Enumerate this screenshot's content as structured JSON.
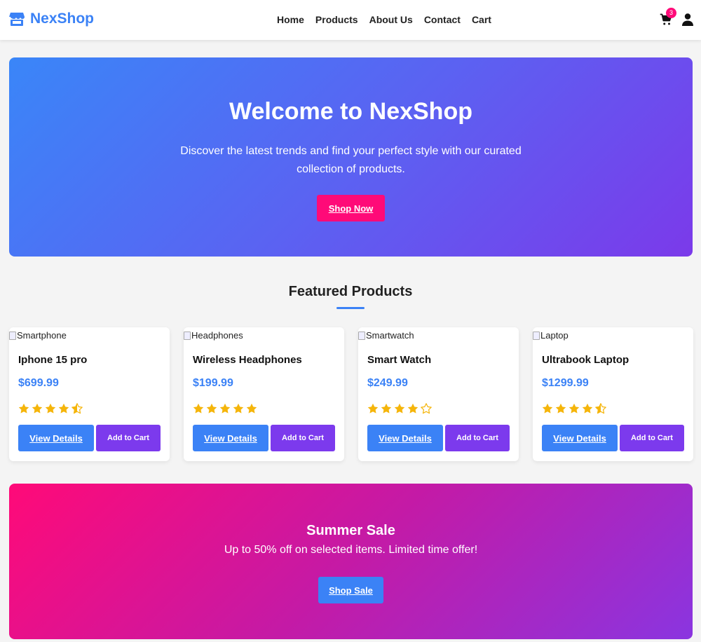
{
  "brand": {
    "name": "NexShop",
    "icon": "store-icon",
    "color": "#3b82f6"
  },
  "nav": {
    "links": [
      "Home",
      "Products",
      "About Us",
      "Contact",
      "Cart"
    ],
    "cart_icon": "shopping-cart-icon",
    "cart_count": "3",
    "user_icon": "user-icon"
  },
  "hero": {
    "title": "Welcome to NexShop",
    "subtitle": "Discover the latest trends and find your perfect style with our curated collection of products.",
    "cta": "Shop Now"
  },
  "featured": {
    "title": "Featured Products",
    "products": [
      {
        "image_alt": "Smartphone",
        "name": "Iphone 15 pro",
        "price": "$699.99",
        "rating": 4.5,
        "view_label": "View Details",
        "add_label": "Add to Cart"
      },
      {
        "image_alt": "Headphones",
        "name": "Wireless Headphones",
        "price": "$199.99",
        "rating": 5,
        "view_label": "View Details",
        "add_label": "Add to Cart"
      },
      {
        "image_alt": "Smartwatch",
        "name": "Smart Watch",
        "price": "$249.99",
        "rating": 4,
        "view_label": "View Details",
        "add_label": "Add to Cart"
      },
      {
        "image_alt": "Laptop",
        "name": "Ultrabook Laptop",
        "price": "$1299.99",
        "rating": 4.5,
        "view_label": "View Details",
        "add_label": "Add to Cart"
      }
    ]
  },
  "sale": {
    "title": "Summer Sale",
    "subtitle": "Up to 50% off on selected items. Limited time offer!",
    "cta": "Shop Sale"
  },
  "colors": {
    "primary": "#3b82f6",
    "accent_pink": "#ff0a78",
    "accent_purple": "#7c3aed",
    "star": "#f5b50a"
  }
}
